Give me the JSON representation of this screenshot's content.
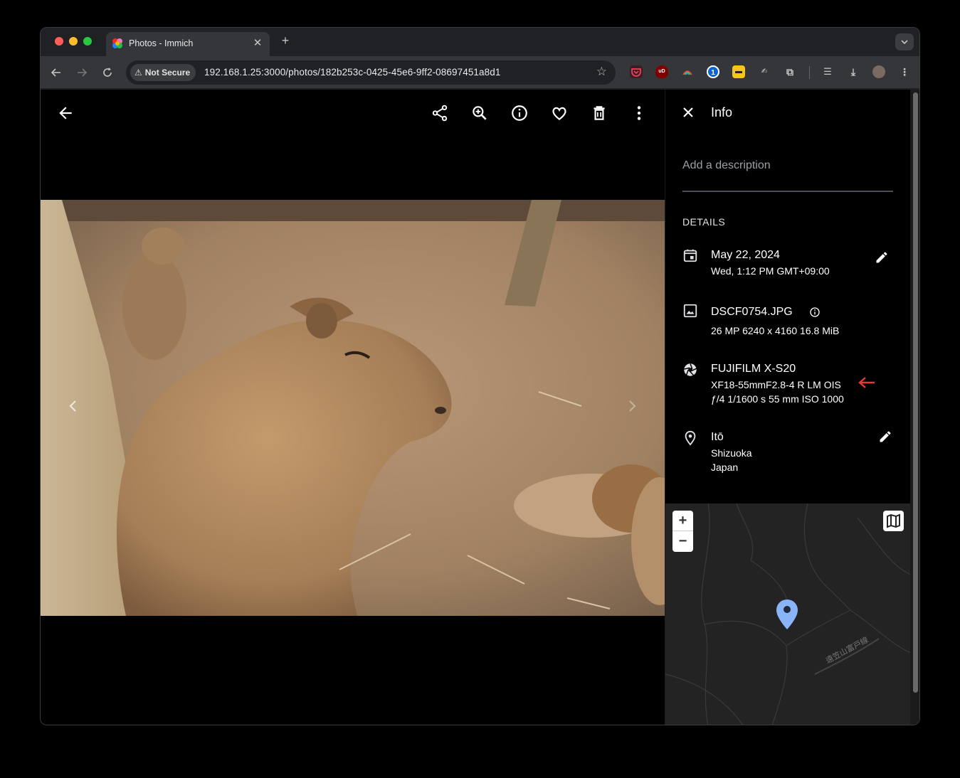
{
  "browser": {
    "tab_title": "Photos - Immich",
    "tab_close": "✕",
    "new_tab": "+",
    "security_label": "Not Secure",
    "url": "192.168.1.25:3000/photos/182b253c-0425-45e6-9ff2-08697451a8d1"
  },
  "viewer": {
    "toolbar_icons": [
      "back-arrow-icon",
      "share-icon",
      "zoom-in-icon",
      "info-icon",
      "heart-icon",
      "trash-icon",
      "more-vert-icon"
    ]
  },
  "info_panel": {
    "title": "Info",
    "description_placeholder": "Add a description",
    "details_heading": "DETAILS",
    "date": {
      "main": "May 22, 2024",
      "sub": "Wed, 1:12 PM GMT+09:00"
    },
    "file": {
      "name": "DSCF0754.JPG",
      "meta": "26 MP  6240 x 4160  16.8 MiB"
    },
    "camera": {
      "model": "FUJIFILM X-S20",
      "lens": "XF18-55mmF2.8-4 R LM OIS",
      "exposure": "ƒ/4  1/1600 s  55 mm  ISO 1000"
    },
    "location": {
      "city": "Itō",
      "state": "Shizuoka",
      "country": "Japan"
    }
  },
  "map": {
    "zoom_in": "+",
    "zoom_out": "−",
    "road_label": "遠笠山富戸線"
  },
  "colors": {
    "accent_pin": "#8ab4f8",
    "annotation_arrow": "#e53935"
  }
}
